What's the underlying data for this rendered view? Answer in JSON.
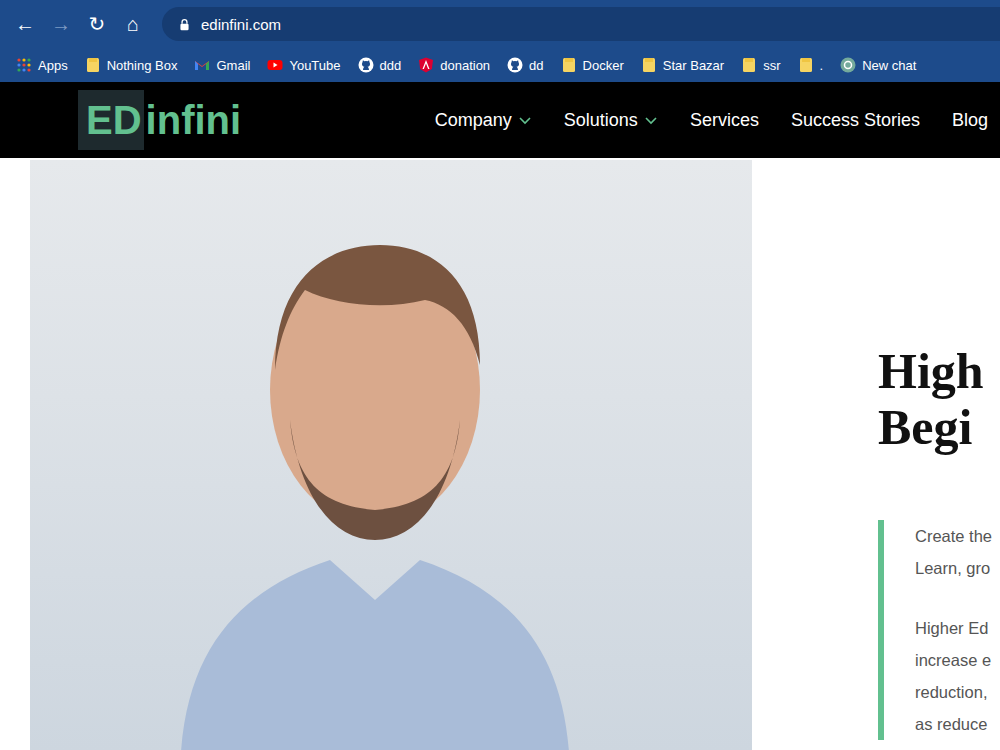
{
  "browser": {
    "back": {
      "glyph": "←",
      "disabled": false
    },
    "forward": {
      "glyph": "→",
      "disabled": true
    },
    "reload": {
      "glyph": "↻",
      "disabled": false
    },
    "home": {
      "glyph": "⌂",
      "disabled": false
    },
    "url": "edinfini.com"
  },
  "bookmarks": [
    {
      "label": "Apps",
      "kind": "apps"
    },
    {
      "label": "Nothing Box",
      "kind": "folder"
    },
    {
      "label": "Gmail",
      "kind": "gmail"
    },
    {
      "label": "YouTube",
      "kind": "youtube"
    },
    {
      "label": "ddd",
      "kind": "github"
    },
    {
      "label": "donation",
      "kind": "angular"
    },
    {
      "label": "dd",
      "kind": "github"
    },
    {
      "label": "Docker",
      "kind": "folder"
    },
    {
      "label": "Star Bazar",
      "kind": "folder"
    },
    {
      "label": "ssr",
      "kind": "folder"
    },
    {
      "label": ".",
      "kind": "folder"
    },
    {
      "label": "New chat",
      "kind": "chatgpt"
    }
  ],
  "site": {
    "logo": {
      "ed": "ED",
      "rest": "infini"
    },
    "menu": [
      {
        "label": "Company",
        "has_menu": true
      },
      {
        "label": "Solutions",
        "has_menu": true
      },
      {
        "label": "Services",
        "has_menu": false
      },
      {
        "label": "Success Stories",
        "has_menu": false
      },
      {
        "label": "Blog",
        "has_menu": false
      }
    ]
  },
  "hero": {
    "heading": [
      "High",
      "Begi"
    ],
    "paragraphs": [
      [
        "Create the",
        "Learn, gro"
      ],
      [
        "Higher Ed",
        "increase e",
        "reduction,",
        "as reduce"
      ]
    ]
  }
}
